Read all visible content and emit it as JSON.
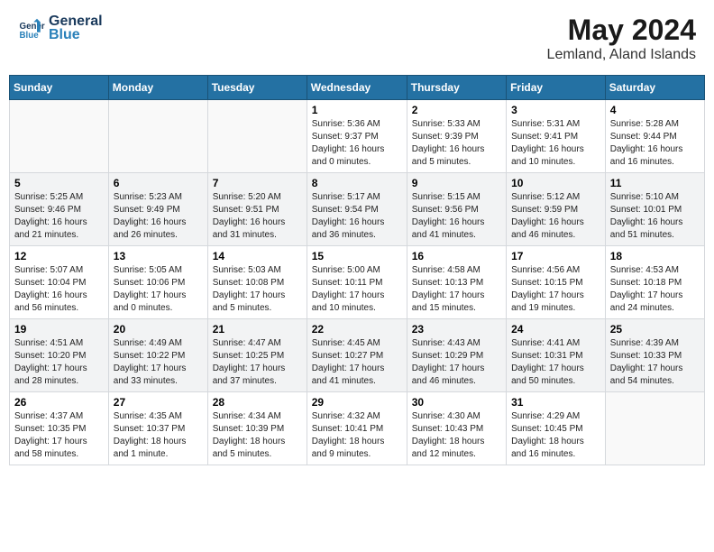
{
  "header": {
    "logo_line1": "General",
    "logo_line2": "Blue",
    "month_title": "May 2024",
    "location": "Lemland, Aland Islands"
  },
  "days_of_week": [
    "Sunday",
    "Monday",
    "Tuesday",
    "Wednesday",
    "Thursday",
    "Friday",
    "Saturday"
  ],
  "weeks": [
    [
      {
        "day": "",
        "info": ""
      },
      {
        "day": "",
        "info": ""
      },
      {
        "day": "",
        "info": ""
      },
      {
        "day": "1",
        "info": "Sunrise: 5:36 AM\nSunset: 9:37 PM\nDaylight: 16 hours\nand 0 minutes."
      },
      {
        "day": "2",
        "info": "Sunrise: 5:33 AM\nSunset: 9:39 PM\nDaylight: 16 hours\nand 5 minutes."
      },
      {
        "day": "3",
        "info": "Sunrise: 5:31 AM\nSunset: 9:41 PM\nDaylight: 16 hours\nand 10 minutes."
      },
      {
        "day": "4",
        "info": "Sunrise: 5:28 AM\nSunset: 9:44 PM\nDaylight: 16 hours\nand 16 minutes."
      }
    ],
    [
      {
        "day": "5",
        "info": "Sunrise: 5:25 AM\nSunset: 9:46 PM\nDaylight: 16 hours\nand 21 minutes."
      },
      {
        "day": "6",
        "info": "Sunrise: 5:23 AM\nSunset: 9:49 PM\nDaylight: 16 hours\nand 26 minutes."
      },
      {
        "day": "7",
        "info": "Sunrise: 5:20 AM\nSunset: 9:51 PM\nDaylight: 16 hours\nand 31 minutes."
      },
      {
        "day": "8",
        "info": "Sunrise: 5:17 AM\nSunset: 9:54 PM\nDaylight: 16 hours\nand 36 minutes."
      },
      {
        "day": "9",
        "info": "Sunrise: 5:15 AM\nSunset: 9:56 PM\nDaylight: 16 hours\nand 41 minutes."
      },
      {
        "day": "10",
        "info": "Sunrise: 5:12 AM\nSunset: 9:59 PM\nDaylight: 16 hours\nand 46 minutes."
      },
      {
        "day": "11",
        "info": "Sunrise: 5:10 AM\nSunset: 10:01 PM\nDaylight: 16 hours\nand 51 minutes."
      }
    ],
    [
      {
        "day": "12",
        "info": "Sunrise: 5:07 AM\nSunset: 10:04 PM\nDaylight: 16 hours\nand 56 minutes."
      },
      {
        "day": "13",
        "info": "Sunrise: 5:05 AM\nSunset: 10:06 PM\nDaylight: 17 hours\nand 0 minutes."
      },
      {
        "day": "14",
        "info": "Sunrise: 5:03 AM\nSunset: 10:08 PM\nDaylight: 17 hours\nand 5 minutes."
      },
      {
        "day": "15",
        "info": "Sunrise: 5:00 AM\nSunset: 10:11 PM\nDaylight: 17 hours\nand 10 minutes."
      },
      {
        "day": "16",
        "info": "Sunrise: 4:58 AM\nSunset: 10:13 PM\nDaylight: 17 hours\nand 15 minutes."
      },
      {
        "day": "17",
        "info": "Sunrise: 4:56 AM\nSunset: 10:15 PM\nDaylight: 17 hours\nand 19 minutes."
      },
      {
        "day": "18",
        "info": "Sunrise: 4:53 AM\nSunset: 10:18 PM\nDaylight: 17 hours\nand 24 minutes."
      }
    ],
    [
      {
        "day": "19",
        "info": "Sunrise: 4:51 AM\nSunset: 10:20 PM\nDaylight: 17 hours\nand 28 minutes."
      },
      {
        "day": "20",
        "info": "Sunrise: 4:49 AM\nSunset: 10:22 PM\nDaylight: 17 hours\nand 33 minutes."
      },
      {
        "day": "21",
        "info": "Sunrise: 4:47 AM\nSunset: 10:25 PM\nDaylight: 17 hours\nand 37 minutes."
      },
      {
        "day": "22",
        "info": "Sunrise: 4:45 AM\nSunset: 10:27 PM\nDaylight: 17 hours\nand 41 minutes."
      },
      {
        "day": "23",
        "info": "Sunrise: 4:43 AM\nSunset: 10:29 PM\nDaylight: 17 hours\nand 46 minutes."
      },
      {
        "day": "24",
        "info": "Sunrise: 4:41 AM\nSunset: 10:31 PM\nDaylight: 17 hours\nand 50 minutes."
      },
      {
        "day": "25",
        "info": "Sunrise: 4:39 AM\nSunset: 10:33 PM\nDaylight: 17 hours\nand 54 minutes."
      }
    ],
    [
      {
        "day": "26",
        "info": "Sunrise: 4:37 AM\nSunset: 10:35 PM\nDaylight: 17 hours\nand 58 minutes."
      },
      {
        "day": "27",
        "info": "Sunrise: 4:35 AM\nSunset: 10:37 PM\nDaylight: 18 hours\nand 1 minute."
      },
      {
        "day": "28",
        "info": "Sunrise: 4:34 AM\nSunset: 10:39 PM\nDaylight: 18 hours\nand 5 minutes."
      },
      {
        "day": "29",
        "info": "Sunrise: 4:32 AM\nSunset: 10:41 PM\nDaylight: 18 hours\nand 9 minutes."
      },
      {
        "day": "30",
        "info": "Sunrise: 4:30 AM\nSunset: 10:43 PM\nDaylight: 18 hours\nand 12 minutes."
      },
      {
        "day": "31",
        "info": "Sunrise: 4:29 AM\nSunset: 10:45 PM\nDaylight: 18 hours\nand 16 minutes."
      },
      {
        "day": "",
        "info": ""
      }
    ]
  ]
}
